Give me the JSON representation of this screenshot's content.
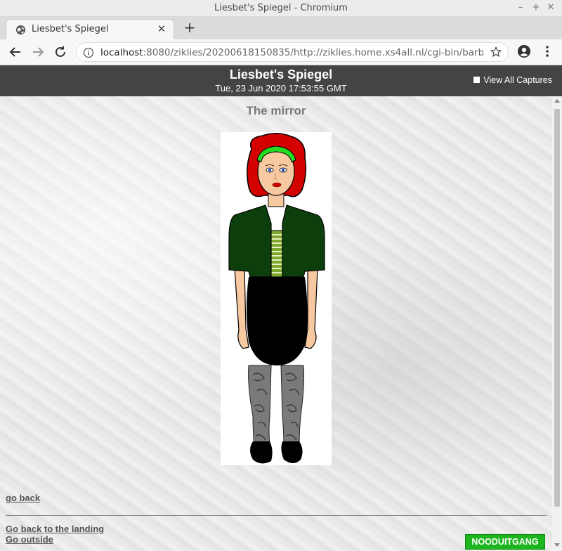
{
  "window": {
    "title": "Liesbet's Spiegel - Chromium",
    "controls": [
      "minimize-icon",
      "maximize-icon",
      "close-icon"
    ]
  },
  "tabs": [
    {
      "title": "Liesbet's Spiegel",
      "favicon": "globe-icon"
    }
  ],
  "address_bar": {
    "host": "localhost",
    "rest": ":8080/ziklies/20200618150835/http://ziklies.home.xs4all.nl/cgi-bin/barbie..."
  },
  "banner": {
    "title": "Liesbet's Spiegel",
    "date": "Tue, 23 Jun 2020 17:53:55 GMT",
    "captures_label": "View All Captures"
  },
  "page": {
    "heading": "The mirror",
    "image_subject": "doll-figure",
    "links": {
      "go_back": "go back",
      "landing": "Go back to the landing",
      "outside": "Go outside"
    },
    "emergency_button": "NOODUITGANG"
  },
  "colors": {
    "banner_bg": "#444444",
    "emergency_green": "#1db51d",
    "hair": "#d40000",
    "headband": "#22dd22",
    "jacket": "#0d3f0d",
    "skirt": "#000000"
  }
}
